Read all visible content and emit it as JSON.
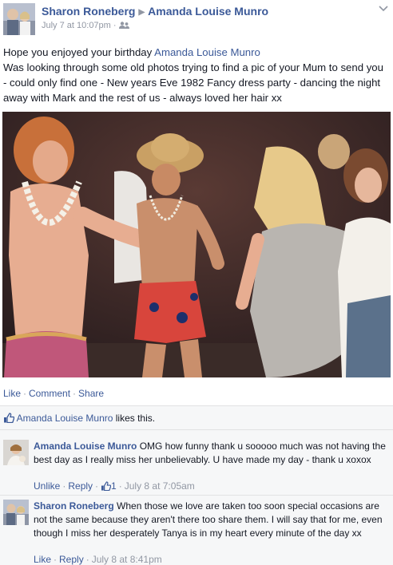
{
  "post": {
    "author": "Sharon Roneberg",
    "recipient": "Amanda Louise Munro",
    "timestamp": "July 7 at 10:07pm",
    "audience_icon": "friends-icon",
    "options_icon": "chevron-down-icon",
    "text_line1_prefix": "Hope you enjoyed your birthday ",
    "text_line1_tag": "Amanda Louise Munro",
    "text_rest": "Was looking through some old photos trying to find a pic of your Mum to send you - could only find one - New years Eve 1982 Fancy dress party - dancing the night away with Mark and the rest of us - always loved her hair xx"
  },
  "actions": {
    "like": "Like",
    "comment": "Comment",
    "share": "Share",
    "sep": "·"
  },
  "likes": {
    "icon": "thumbs-up-icon",
    "name": "Amanda Louise Munro",
    "suffix": " likes this."
  },
  "comments": [
    {
      "author": "Amanda Louise Munro",
      "text": "OMG how funny thank u sooooo much was not having the best day as I really miss her unbelievably. U have made my day - thank u xoxox",
      "unlike": "Unlike",
      "reply": "Reply",
      "like_count": "1",
      "time": "July 8 at 7:05am"
    },
    {
      "author": "Sharon Roneberg",
      "text": "When those we love are taken too soon special occasions are not the same because they aren't there too share them. I will say that for me, even though I miss her desperately Tanya is in my heart every minute of the day xx",
      "like": "Like",
      "reply": "Reply",
      "time": "July 8 at 8:41pm"
    }
  ],
  "colors": {
    "link": "#3b5998",
    "meta": "#9197a3",
    "text": "#141823",
    "ufi_bg": "#f6f7f8"
  }
}
